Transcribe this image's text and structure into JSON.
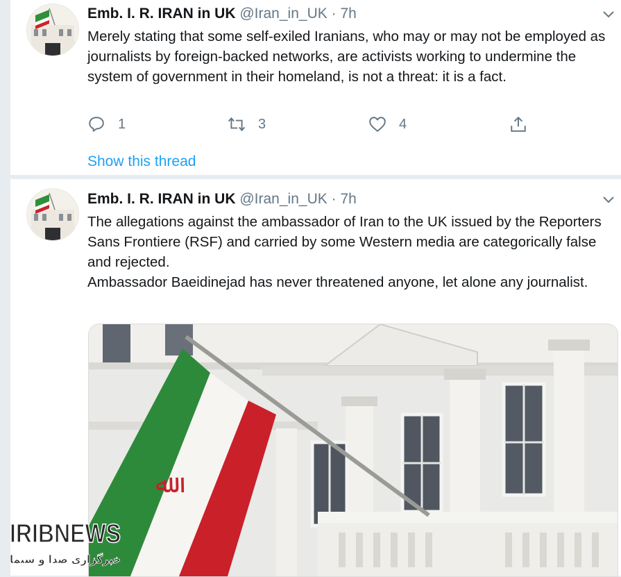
{
  "tweets": [
    {
      "display_name": "Emb. I. R. IRAN in UK",
      "handle": "@Iran_in_UK",
      "separator": "·",
      "time": "7h",
      "text": [
        "Merely stating that some self-exiled Iranians, who may or may not be employed as journalists by foreign-backed networks, are activists working to undermine the system of government in their homeland, is not a threat: it is a fact."
      ],
      "reply_count": "1",
      "retweet_count": "3",
      "like_count": "4",
      "show_thread": "Show this thread"
    },
    {
      "display_name": "Emb. I. R. IRAN in UK",
      "handle": "@Iran_in_UK",
      "separator": "·",
      "time": "7h",
      "text": [
        "The allegations against the ambassador of Iran to the UK issued by the Reporters Sans Frontiere (RSF) and carried by some Western media are categorically false and rejected.",
        "Ambassador Baeidinejad has never threatened anyone, let alone any journalist."
      ]
    }
  ],
  "watermark": {
    "brand": "IRIBNEWS",
    "subtitle": "خبرگزاری صدا و سیما"
  },
  "icons": {
    "reply": "reply-icon",
    "retweet": "retweet-icon",
    "like": "heart-icon",
    "share": "share-icon",
    "caret": "chevron-down-icon"
  },
  "colors": {
    "link": "#1da1f2",
    "muted": "#657786",
    "text": "#14171a",
    "background": "#e6ecf0"
  }
}
